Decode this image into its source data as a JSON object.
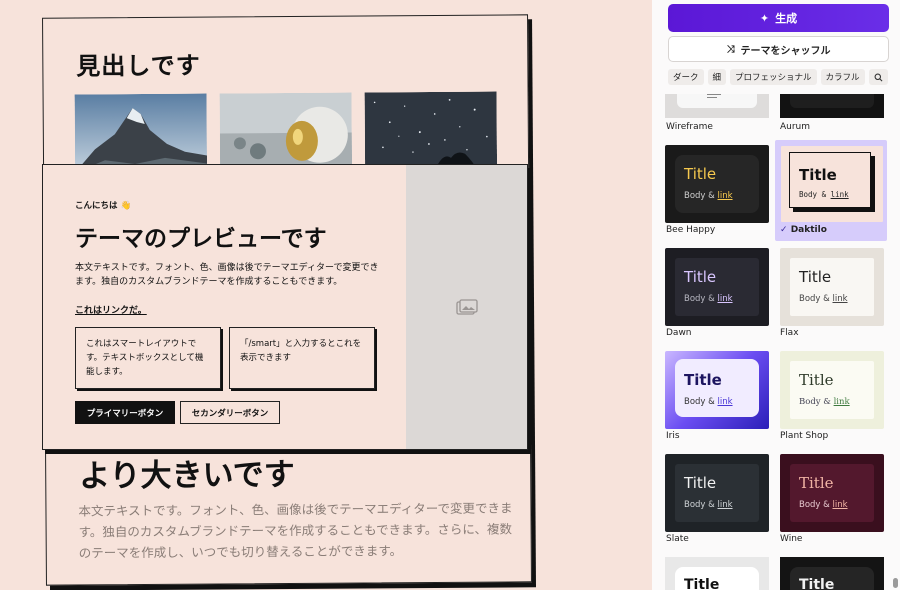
{
  "preview": {
    "heading": "見出しです",
    "greeting": "こんにちは 👋",
    "title": "テーマのプレビューです",
    "body": "本文テキストです。フォント、色、画像は後でテーマエディターで変更できます。独自のカスタムブランドテーマを作成することもできます。",
    "link": "これはリンクだ。",
    "box1": "これはスマートレイアウトです。テキストボックスとして機能します。",
    "box2": "「/smart」と入力するとこれを表示できます",
    "primary_btn": "プライマリーボタン",
    "secondary_btn": "セカンダリーボタン",
    "bigger_heading": "より大きいです",
    "bigger_para": "本文テキストです。フォント、色、画像は後でテーマエディターで変更できます。独自のカスタムブランドテーマを作成することもできます。さらに、複数のテーマを作成し、いつでも切り替えることができます。"
  },
  "panel": {
    "generate_label": "生成",
    "shuffle_label": "テーマをシャッフル",
    "filters": [
      "ダーク",
      "細",
      "プロフェッショナル",
      "カラフル"
    ],
    "themes": [
      {
        "name": "Wireframe",
        "selected": false
      },
      {
        "name": "Aurum",
        "selected": false
      },
      {
        "name": "Bee Happy",
        "selected": false
      },
      {
        "name": "Daktilo",
        "selected": true
      },
      {
        "name": "Dawn",
        "selected": false
      },
      {
        "name": "Flax",
        "selected": false
      },
      {
        "name": "Iris",
        "selected": false
      },
      {
        "name": "Plant Shop",
        "selected": false
      },
      {
        "name": "Slate",
        "selected": false
      },
      {
        "name": "Wine",
        "selected": false
      }
    ],
    "tile_title": "Title",
    "tile_body": "Body & ",
    "tile_link": "link"
  }
}
